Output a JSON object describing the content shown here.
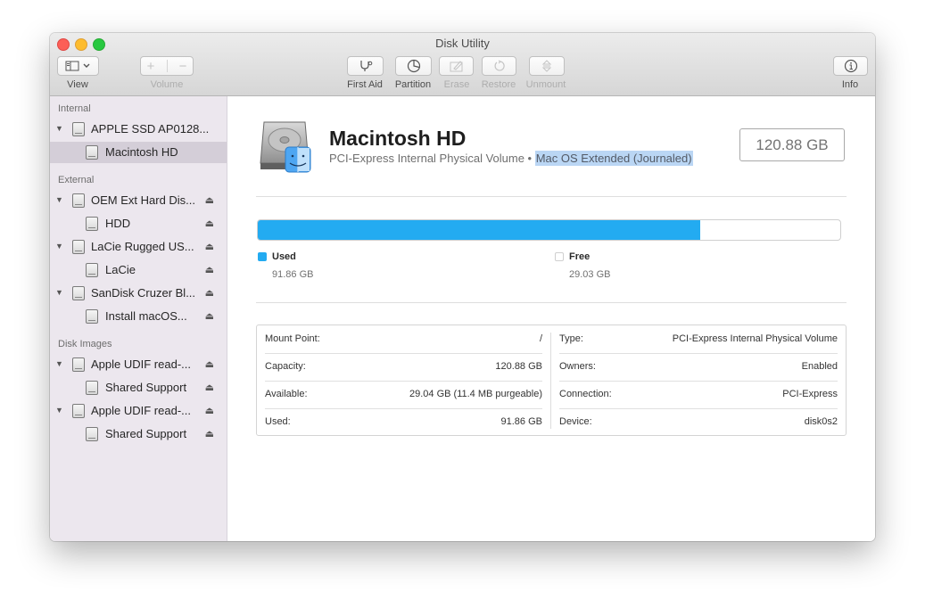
{
  "window": {
    "title": "Disk Utility"
  },
  "toolbar": {
    "view_label": "View",
    "volume_label": "Volume",
    "volume_add": "+",
    "volume_remove": "−",
    "first_aid_label": "First Aid",
    "partition_label": "Partition",
    "erase_label": "Erase",
    "restore_label": "Restore",
    "unmount_label": "Unmount",
    "info_label": "Info"
  },
  "sidebar": {
    "sections": [
      {
        "title": "Internal",
        "items": [
          {
            "label": "APPLE SSD AP0128...",
            "level": 0,
            "expanded": true,
            "eject": false
          },
          {
            "label": "Macintosh HD",
            "level": 1,
            "selected": true,
            "eject": false
          }
        ]
      },
      {
        "title": "External",
        "items": [
          {
            "label": "OEM Ext Hard Dis...",
            "level": 0,
            "expanded": true,
            "eject": true
          },
          {
            "label": "HDD",
            "level": 1,
            "eject": true
          },
          {
            "label": "LaCie Rugged US...",
            "level": 0,
            "expanded": true,
            "eject": true
          },
          {
            "label": "LaCie",
            "level": 1,
            "eject": true
          },
          {
            "label": "SanDisk Cruzer Bl...",
            "level": 0,
            "expanded": true,
            "eject": true
          },
          {
            "label": "Install macOS...",
            "level": 1,
            "eject": true
          }
        ]
      },
      {
        "title": "Disk Images",
        "items": [
          {
            "label": "Apple UDIF read-...",
            "level": 0,
            "expanded": true,
            "eject": true
          },
          {
            "label": "Shared Support",
            "level": 1,
            "eject": true
          },
          {
            "label": "Apple UDIF read-...",
            "level": 0,
            "expanded": true,
            "eject": true
          },
          {
            "label": "Shared Support",
            "level": 1,
            "eject": true
          }
        ]
      }
    ]
  },
  "volume": {
    "name": "Macintosh HD",
    "subtitle_type": "PCI-Express Internal Physical Volume",
    "subtitle_sep": " • ",
    "subtitle_format": "Mac OS Extended (Journaled)",
    "capacity": "120.88 GB"
  },
  "usage": {
    "used_fraction": 0.76,
    "used_color": "#23abf1",
    "free_color": "#ffffff",
    "used_label": "Used",
    "used_value": "91.86 GB",
    "free_label": "Free",
    "free_value": "29.03 GB"
  },
  "info": {
    "left": [
      {
        "key": "Mount Point:",
        "value": "/"
      },
      {
        "key": "Capacity:",
        "value": "120.88 GB"
      },
      {
        "key": "Available:",
        "value": "29.04 GB (11.4 MB purgeable)"
      },
      {
        "key": "Used:",
        "value": "91.86 GB"
      }
    ],
    "right": [
      {
        "key": "Type:",
        "value": "PCI-Express Internal Physical Volume"
      },
      {
        "key": "Owners:",
        "value": "Enabled"
      },
      {
        "key": "Connection:",
        "value": "PCI-Express"
      },
      {
        "key": "Device:",
        "value": "disk0s2"
      }
    ]
  }
}
